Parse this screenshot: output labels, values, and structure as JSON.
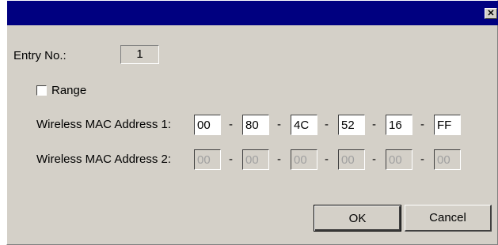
{
  "window": {
    "title": ""
  },
  "form": {
    "entry_label": "Entry No.:",
    "entry_value": "1",
    "range_label": "Range",
    "mac1_label": "Wireless MAC Address 1:",
    "mac1": [
      "00",
      "80",
      "4C",
      "52",
      "16",
      "FF"
    ],
    "mac2_label": "Wireless MAC Address 2:",
    "mac2": [
      "00",
      "00",
      "00",
      "00",
      "00",
      "00"
    ],
    "separator": "-"
  },
  "buttons": {
    "ok": "OK",
    "cancel": "Cancel"
  },
  "icons": {
    "close": "close-icon",
    "range_checkbox": "checkbox-icon"
  },
  "colors": {
    "titlebar": "#000080",
    "dialog": "#d4d0c8"
  }
}
